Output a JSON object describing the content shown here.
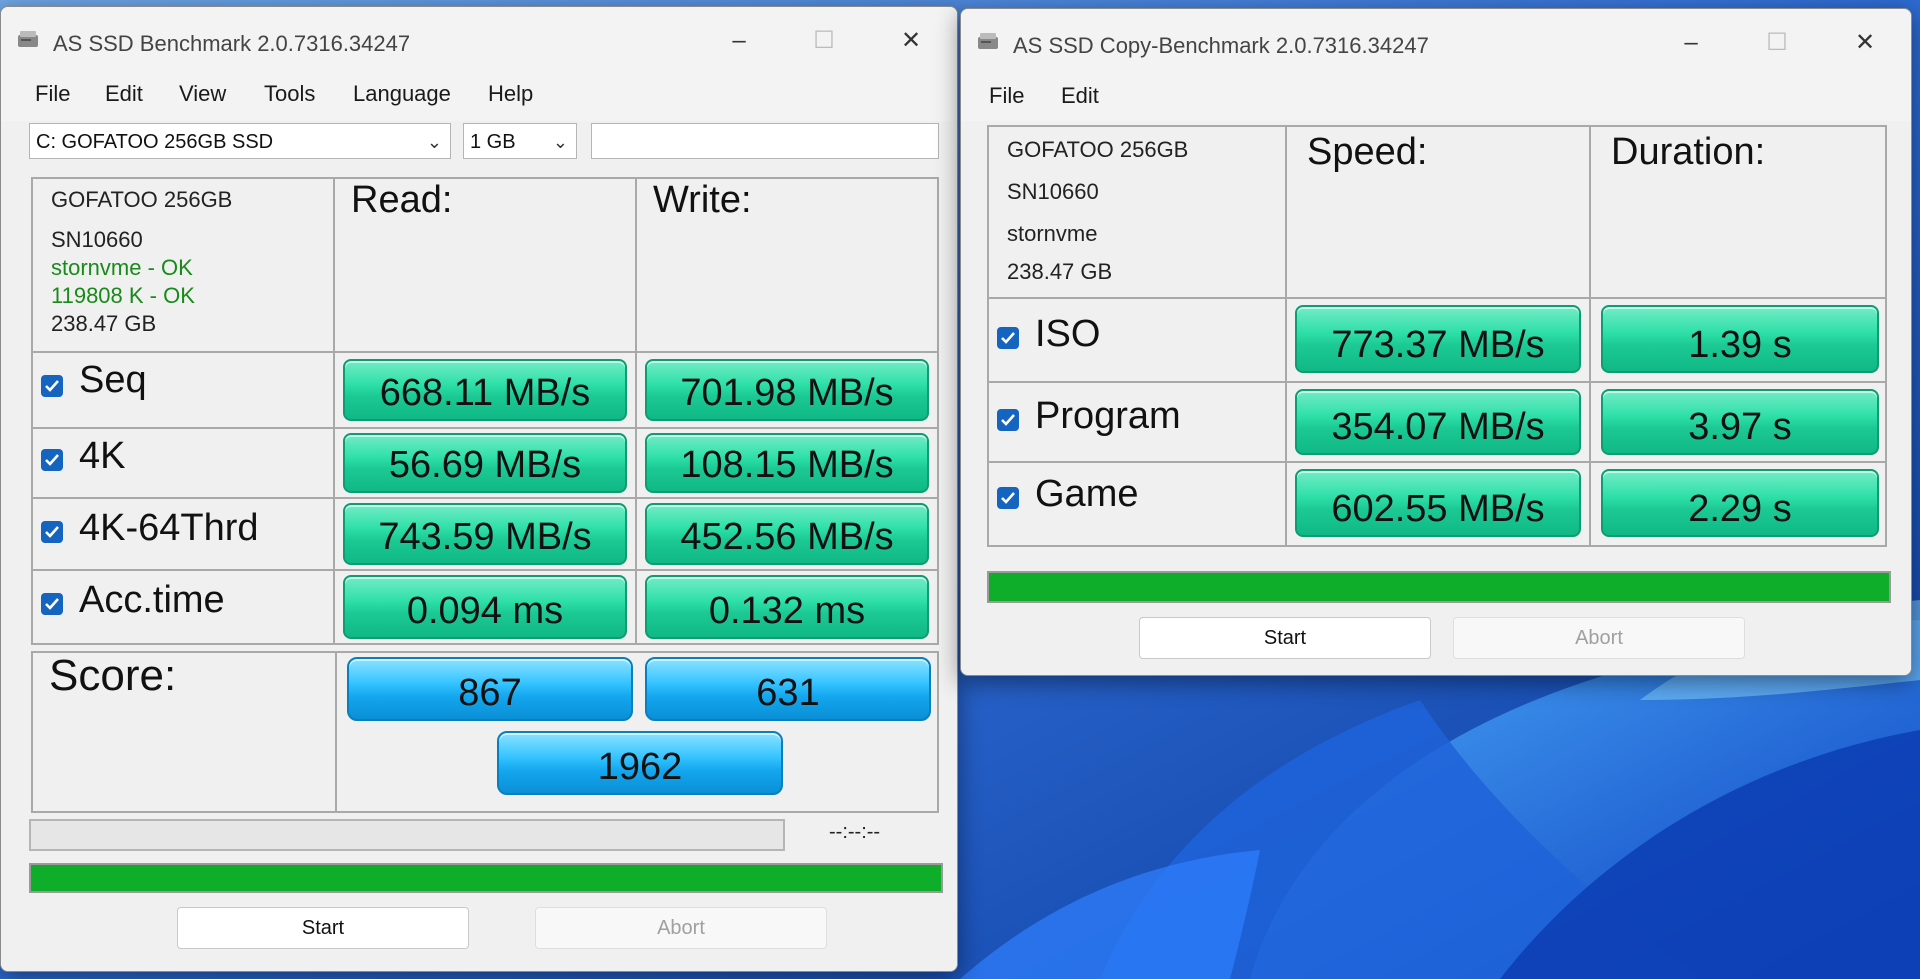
{
  "colors": {
    "green_result": "#2ee0a8",
    "blue_score": "#36c4ff",
    "progress": "#0fae2a"
  },
  "bench": {
    "title": "AS SSD Benchmark 2.0.7316.34247",
    "menu": [
      "File",
      "Edit",
      "View",
      "Tools",
      "Language",
      "Help"
    ],
    "drive_select": "C: GOFATOO 256GB SSD",
    "size_select": "1 GB",
    "text_box": "",
    "drive_info": {
      "model": "GOFATOO 256GB",
      "firmware": "SN10660",
      "driver": "stornvme - OK",
      "alignment": "119808 K - OK",
      "capacity": "238.47 GB"
    },
    "col_read": "Read:",
    "col_write": "Write:",
    "rows": [
      {
        "label": "Seq",
        "read": "668.11 MB/s",
        "write": "701.98 MB/s",
        "checked": true
      },
      {
        "label": "4K",
        "read": "56.69 MB/s",
        "write": "108.15 MB/s",
        "checked": true
      },
      {
        "label": "4K-64Thrd",
        "read": "743.59 MB/s",
        "write": "452.56 MB/s",
        "checked": true
      },
      {
        "label": "Acc.time",
        "read": "0.094 ms",
        "write": "0.132 ms",
        "checked": true
      }
    ],
    "score_label": "Score:",
    "score_read": "867",
    "score_write": "631",
    "score_total": "1962",
    "time_display": "--:--:--",
    "progress_fraction": 1.0,
    "start_label": "Start",
    "abort_label": "Abort",
    "window_icon": "drive-icon",
    "controls": {
      "minimize": "minimize-icon",
      "maximize": "maximize-icon",
      "close": "close-icon"
    }
  },
  "copy": {
    "title": "AS SSD Copy-Benchmark 2.0.7316.34247",
    "menu": [
      "File",
      "Edit"
    ],
    "drive_info": {
      "model": "GOFATOO 256GB",
      "firmware": "SN10660",
      "driver": "stornvme",
      "capacity": "238.47 GB"
    },
    "col_speed": "Speed:",
    "col_duration": "Duration:",
    "rows": [
      {
        "label": "ISO",
        "speed": "773.37 MB/s",
        "duration": "1.39 s",
        "checked": true
      },
      {
        "label": "Program",
        "speed": "354.07 MB/s",
        "duration": "3.97 s",
        "checked": true
      },
      {
        "label": "Game",
        "speed": "602.55 MB/s",
        "duration": "2.29 s",
        "checked": true
      }
    ],
    "progress_fraction": 1.0,
    "start_label": "Start",
    "abort_label": "Abort"
  }
}
